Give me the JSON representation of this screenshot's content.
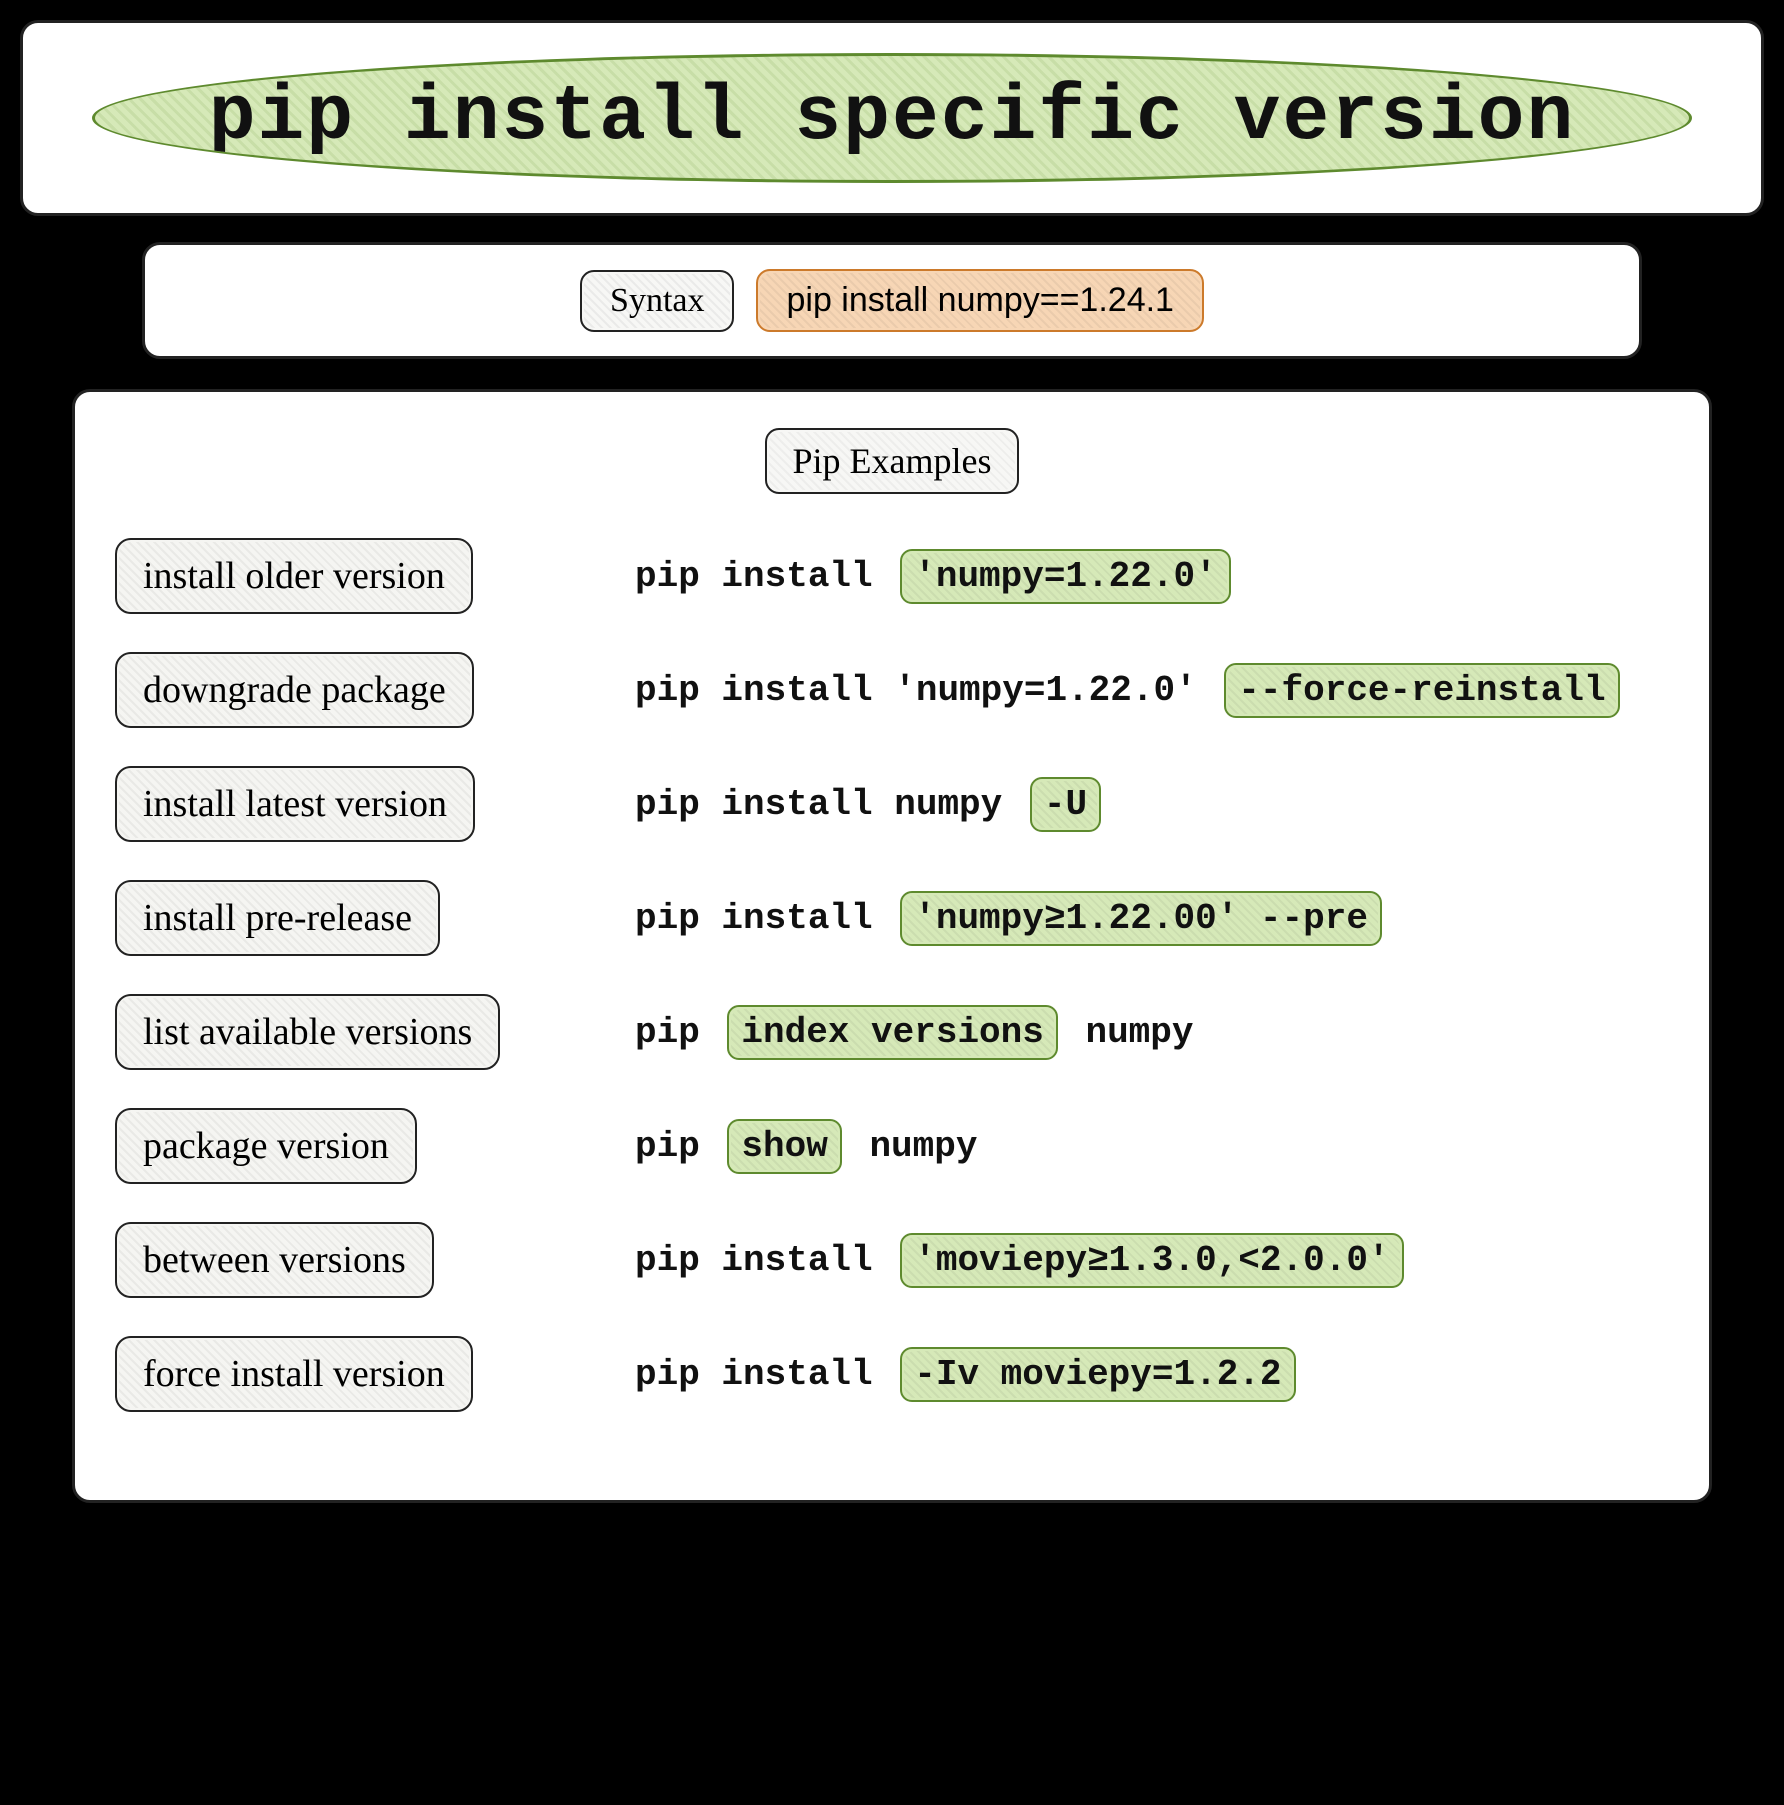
{
  "title": "pip install specific version",
  "syntax": {
    "label": "Syntax",
    "command": "pip install numpy==1.24.1"
  },
  "section_title": "Pip Examples",
  "rows": [
    {
      "label": "install older version",
      "pre": "pip install ",
      "hl": "'numpy=1.22.0'",
      "post": ""
    },
    {
      "label": "downgrade package",
      "pre": "pip install 'numpy=1.22.0' ",
      "hl": "--force-reinstall",
      "post": ""
    },
    {
      "label": "install latest version",
      "pre": "pip install numpy ",
      "hl": "-U",
      "post": ""
    },
    {
      "label": "install pre-release",
      "pre": "pip install ",
      "hl": "'numpy≥1.22.00' --pre",
      "post": ""
    },
    {
      "label": "list available versions",
      "pre": "pip ",
      "hl": "index versions",
      "post": " numpy"
    },
    {
      "label": "package version",
      "pre": "pip ",
      "hl": "show",
      "post": " numpy"
    },
    {
      "label": "between versions",
      "pre": "pip install ",
      "hl": "'moviepy≥1.3.0,<2.0.0'",
      "post": ""
    },
    {
      "label": "force install version",
      "pre": "pip install ",
      "hl": "-Iv moviepy=1.2.2",
      "post": ""
    }
  ]
}
